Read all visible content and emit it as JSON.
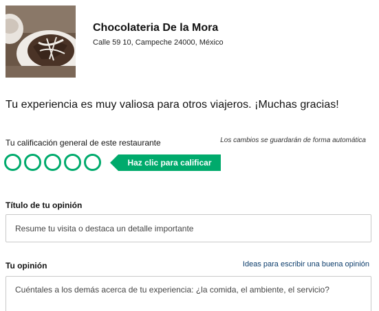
{
  "restaurant": {
    "name": "Chocolateria De la Mora",
    "address": "Calle 59 10, Campeche 24000, México"
  },
  "thanks_message": "Tu experiencia es muy valiosa para otros viajeros. ¡Muchas gracias!",
  "rating": {
    "label": "Tu calificación general de este restaurante",
    "autosave_note": "Los cambios se guardarán de forma automática",
    "button_label": "Haz clic para calificar",
    "max": 5,
    "value": 0
  },
  "title_field": {
    "label": "Título de tu opinión",
    "placeholder": "Resume tu visita o destaca un detalle importante",
    "value": ""
  },
  "opinion_field": {
    "label": "Tu opinión",
    "link": "Ideas para escribir una buena opinión",
    "placeholder": "Cuéntales a los demás acerca de tu experiencia: ¿la comida, el ambiente, el servicio?",
    "value": ""
  },
  "colors": {
    "accent": "#00aa6c",
    "link": "#0b3c6b",
    "border": "#c9c9c9"
  }
}
